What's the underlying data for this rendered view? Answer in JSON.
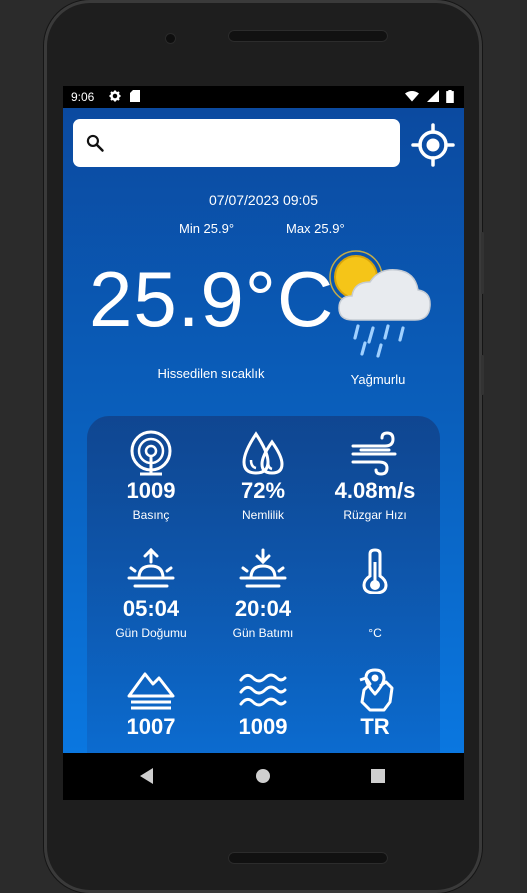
{
  "status_bar": {
    "time": "9:06"
  },
  "search": {
    "placeholder": "",
    "value": ""
  },
  "weather": {
    "datetime": "07/07/2023 09:05",
    "min": "Min 25.9°",
    "max": "Max 25.9°",
    "temperature": "25.9°C",
    "feels_like_label": "Hissedilen sıcaklık",
    "condition": "Yağmurlu",
    "icon": "sun-cloud-rain-icon"
  },
  "details": {
    "pressure": {
      "value": "1009",
      "label": "Basınç",
      "icon": "pressure-gauge-icon"
    },
    "humidity": {
      "value": "72%",
      "label": "Nemlilik",
      "icon": "droplets-icon"
    },
    "wind": {
      "value": "4.08m/s",
      "label": "Rüzgar Hızı",
      "icon": "wind-icon"
    },
    "sunrise": {
      "value": "05:04",
      "label": "Gün Doğumu",
      "icon": "sunrise-icon"
    },
    "sunset": {
      "value": "20:04",
      "label": "Gün Batımı",
      "icon": "sunset-icon"
    },
    "feels": {
      "value": "",
      "label": "°C",
      "icon": "thermometer-icon"
    },
    "ground_level": {
      "value": "1007",
      "label": "",
      "icon": "mountain-icon"
    },
    "sea_level": {
      "value": "1009",
      "label": "",
      "icon": "waves-icon"
    },
    "country": {
      "value": "TR",
      "label": "",
      "icon": "map-pin-icon"
    }
  },
  "colors": {
    "gradient_top": "#0b4aa0",
    "gradient_bottom": "#0a77e0",
    "sun": "#f5c518"
  }
}
